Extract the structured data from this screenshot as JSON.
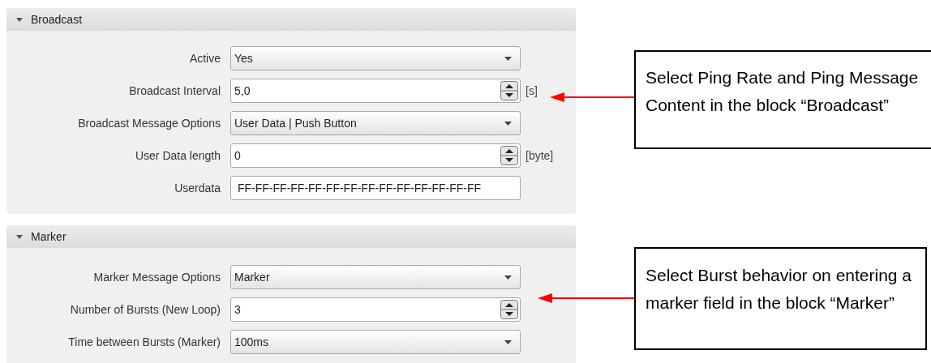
{
  "sections": [
    {
      "title": "Broadcast",
      "expanded": true,
      "fields": [
        {
          "kind": "dropdown",
          "label": "Active",
          "value": "Yes"
        },
        {
          "kind": "spinner",
          "label": "Broadcast Interval",
          "value": "5,0",
          "unit": "[s]"
        },
        {
          "kind": "dropdown",
          "label": "Broadcast Message Options",
          "value": "User Data | Push Button"
        },
        {
          "kind": "spinner",
          "label": "User Data length",
          "value": "0",
          "unit": "[byte]"
        },
        {
          "kind": "text",
          "label": "Userdata",
          "value": "FF-FF-FF-FF-FF-FF-FF-FF-FF-FF-FF-FF-FF-FF"
        }
      ]
    },
    {
      "title": "Marker",
      "expanded": true,
      "fields": [
        {
          "kind": "dropdown",
          "label": "Marker Message Options",
          "value": "Marker"
        },
        {
          "kind": "spinner",
          "label": "Number of Bursts (New Loop)",
          "value": "3"
        },
        {
          "kind": "dropdown",
          "label": "Time between Bursts (Marker)",
          "value": "100ms"
        }
      ]
    }
  ],
  "callouts": [
    {
      "text": "Select Ping Rate and Ping Message Content in the block “Broadcast”"
    },
    {
      "text": "Select Burst behavior on entering a marker field in the block “Marker”"
    }
  ]
}
